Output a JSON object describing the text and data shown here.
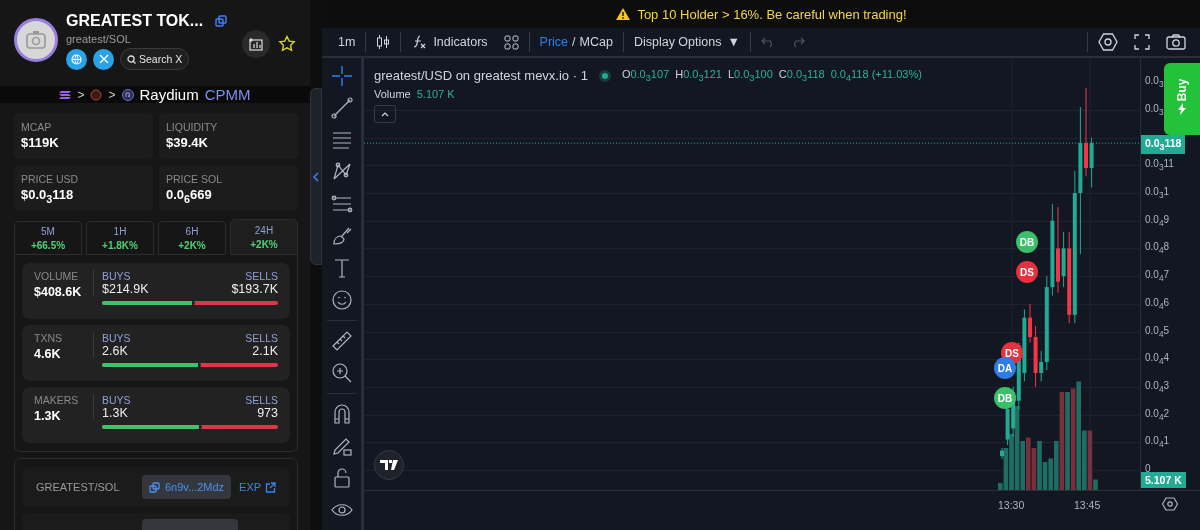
{
  "token": {
    "name": "GREATEST TOK...",
    "pair": "greatest/SOL",
    "search_label": "Search X"
  },
  "route": {
    "separators": [
      ">",
      ">"
    ],
    "dex": "Raydium",
    "pool_type": "CPMM"
  },
  "stats": [
    {
      "label": "MCAP",
      "value": "$119K"
    },
    {
      "label": "LIQUIDITY",
      "value": "$39.4K"
    },
    {
      "label": "PRICE USD",
      "value": "$0.0$_{3}$118"
    },
    {
      "label": "PRICE SOL",
      "value": "0.0$_{6}$669"
    }
  ],
  "timeframes": [
    {
      "label": "5M",
      "change": "+66.5%",
      "selected": false
    },
    {
      "label": "1H",
      "change": "+1.8K%",
      "selected": false
    },
    {
      "label": "6H",
      "change": "+2K%",
      "selected": false
    },
    {
      "label": "24H",
      "change": "+2K%",
      "selected": true
    }
  ],
  "trade_rows": [
    {
      "label": "VOLUME",
      "total": "$408.6K",
      "buys_label": "BUYS",
      "buys": "$214.9K",
      "sells_label": "SELLS",
      "sells": "$193.7K",
      "level": 0.53
    },
    {
      "label": "TXNS",
      "total": "4.6K",
      "buys_label": "BUYS",
      "buys": "2.6K",
      "sells_label": "SELLS",
      "sells": "2.1K",
      "level": 0.56
    },
    {
      "label": "MAKERS",
      "total": "1.3K",
      "buys_label": "BUYS",
      "buys": "1.3K",
      "sells_label": "SELLS",
      "sells": "973",
      "level": 0.57
    }
  ],
  "pair_card": {
    "label": "GREATEST/SOL",
    "address": "6n9v...2Mdz",
    "link": "EXP"
  },
  "warning": "Top 10 Holder > 16%. Be careful when trading!",
  "toolbar": {
    "interval": "1m",
    "indicators": "Indicators",
    "price": "Price",
    "separator": "/",
    "mcap": "MCap",
    "display_options": "Display Options",
    "display_caret": "▼"
  },
  "chart": {
    "title": "greatest/USD on greatest mevx.io · 1",
    "ohlc": [
      {
        "key": "O",
        "value": "0.0$_{3}$107"
      },
      {
        "key": "H",
        "value": "0.0$_{3}$121"
      },
      {
        "key": "L",
        "value": "0.0$_{3}$100"
      },
      {
        "key": "C",
        "value": "0.0$_{3}$118"
      }
    ],
    "change": "0.0$_{4}$118 (+11.03%)",
    "volume_label": "Volume",
    "volume_value": "5.107 K",
    "price_ticks": [
      "0.0$_{3}$",
      "0.0$_{3}$",
      "0.0$_{3}$11",
      "0.0$_{3}$1",
      "0.0$_{4}$9",
      "0.0$_{4}$8",
      "0.0$_{4}$7",
      "0.0$_{4}$6",
      "0.0$_{4}$5",
      "0.0$_{4}$4",
      "0.0$_{4}$3",
      "0.0$_{4}$2",
      "0.0$_{4}$1",
      "0"
    ],
    "last_price": "0.0$_{3}$118",
    "last_volume": "5.107 K",
    "time_ticks": [
      "13:30",
      "13:45"
    ],
    "markers": [
      {
        "label": "DB",
        "color": "#3bbf6a"
      },
      {
        "label": "DS",
        "color": "#e8313f"
      },
      {
        "label": "DS",
        "color": "#e8313f"
      },
      {
        "label": "DA",
        "color": "#2f7de1"
      },
      {
        "label": "DB",
        "color": "#3bbf6a"
      }
    ]
  },
  "buy_button": "Buy"
}
